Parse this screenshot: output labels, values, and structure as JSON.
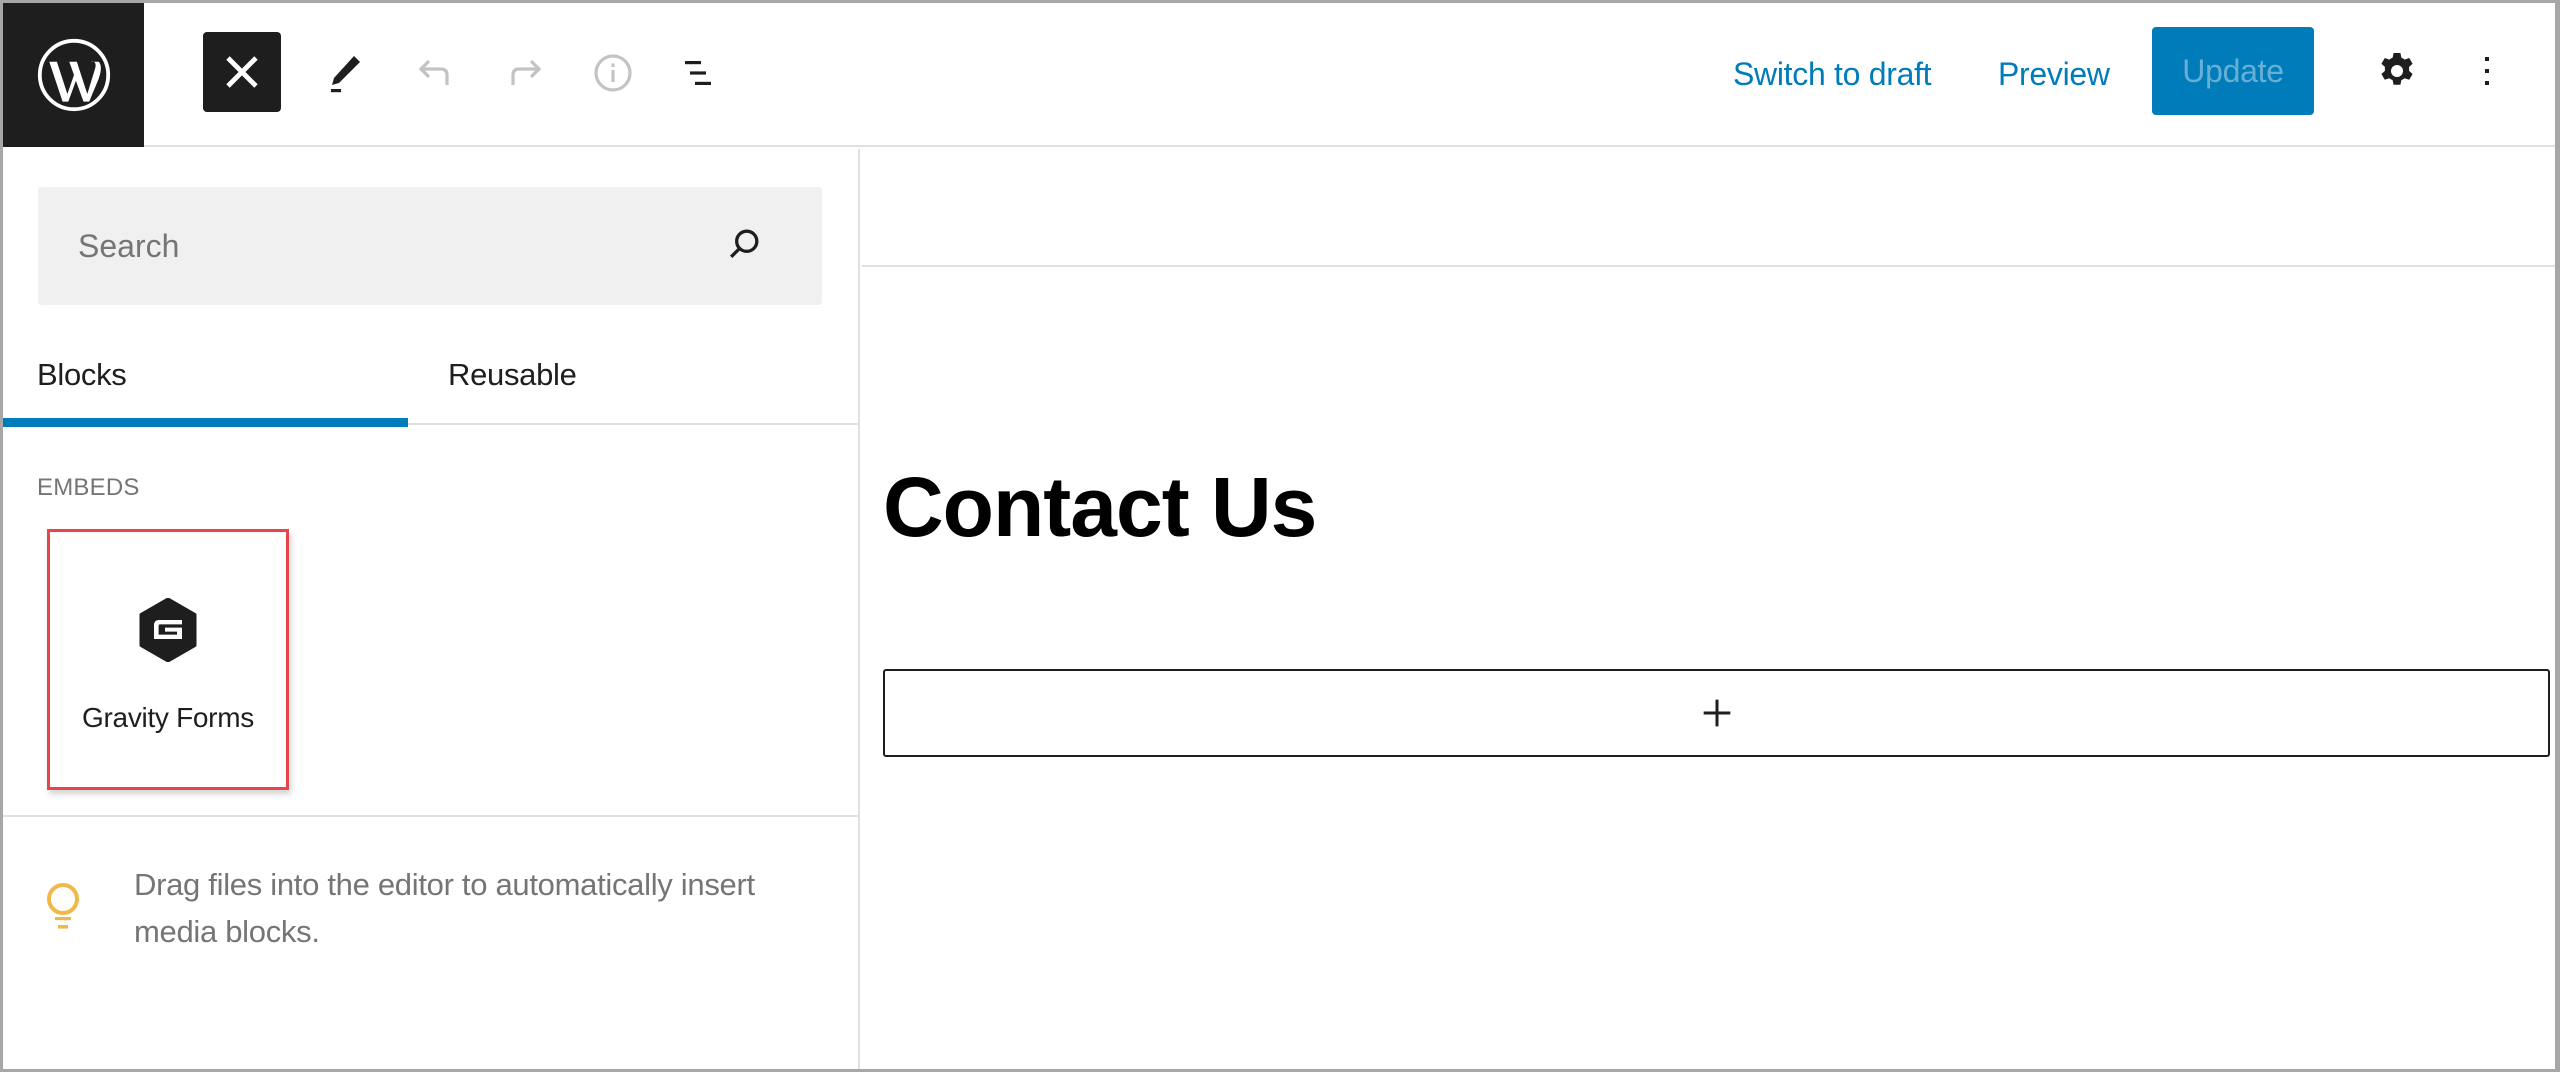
{
  "header": {
    "logo": "wordpress-logo-icon",
    "close_icon": "close-icon",
    "tools_icon": "pencil-icon",
    "undo_icon": "undo-icon",
    "redo_icon": "redo-icon",
    "details_icon": "info-icon",
    "list_view_icon": "list-view-icon",
    "switch_to_draft_label": "Switch to draft",
    "preview_label": "Preview",
    "update_label": "Update",
    "settings_icon": "gear-icon",
    "options_icon": "more-vertical-icon"
  },
  "colors": {
    "accent": "#007cba",
    "dark": "#1e1e1e",
    "highlight_border": "#e8454a",
    "tip_icon": "#f0b849",
    "muted_text": "#757575"
  },
  "sidebar": {
    "search": {
      "placeholder": "Search",
      "value": ""
    },
    "tabs": [
      {
        "label": "Blocks",
        "active": true
      },
      {
        "label": "Reusable",
        "active": false
      }
    ],
    "category_label": "EMBEDS",
    "blocks": [
      {
        "label": "Gravity Forms",
        "icon": "gravity-forms-icon",
        "highlighted": true
      }
    ],
    "tip": {
      "icon": "lightbulb-icon",
      "text": "Drag files into the editor to automatically insert media blocks."
    }
  },
  "editor": {
    "title": "Contact Us",
    "appender_icon": "plus-icon"
  }
}
